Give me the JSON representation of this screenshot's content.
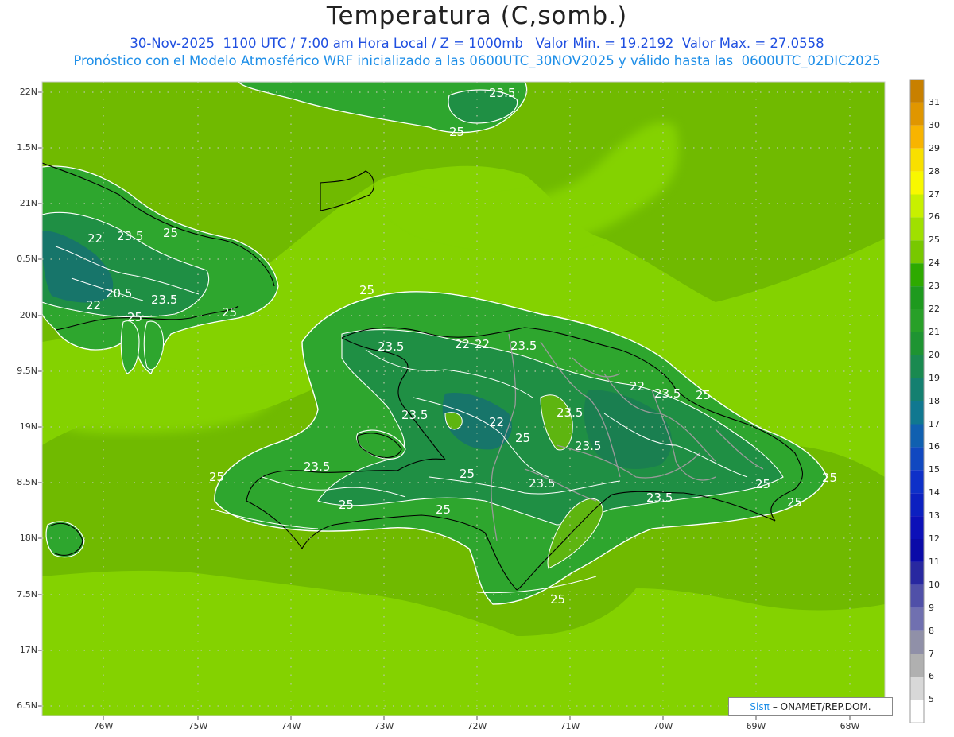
{
  "header": {
    "title": "Temperatura (C,somb.)",
    "subtitle_1": "30-Nov-2025  1100 UTC / 7:00 am Hora Local / Z = 1000mb   Valor Min. = 19.2192  Valor Max. = 27.0558",
    "subtitle_2": "Pronóstico con el Modelo Atmosférico WRF inicializado a las 0600UTC_30NOV2025 y válido hasta las  0600UTC_02DIC2025"
  },
  "axes": {
    "lat_labels": [
      "22N",
      "1.5N",
      "21N",
      "0.5N",
      "20N",
      "9.5N",
      "19N",
      "8.5N",
      "18N",
      "7.5N",
      "17N",
      "6.5N"
    ],
    "lon_labels": [
      "76W",
      "75W",
      "74W",
      "73W",
      "72W",
      "71W",
      "70W",
      "69W",
      "68W"
    ]
  },
  "colors": {
    "ocean_far": "#84d200",
    "ocean_mid": "#6fba00",
    "land_warm": "#2ea62e",
    "land_cool": "#1f8f44",
    "land_coldest": "#17756a",
    "contour": "#ffffff",
    "border": "#9a9a9a",
    "coast": "#000000"
  },
  "contour_labels": [
    "23.5",
    "25",
    "22",
    "23.5",
    "25",
    "20.5",
    "23.5",
    "22",
    "25",
    "25",
    "25",
    "23.5",
    "22",
    "22",
    "23.5",
    "22",
    "23.5",
    "25",
    "23.5",
    "22",
    "25",
    "23.5",
    "23.5",
    "25",
    "23.5",
    "25",
    "23.5",
    "23.5",
    "25",
    "25",
    "25",
    "25",
    "25",
    "25"
  ],
  "colorbar": {
    "levels": [
      "31",
      "30",
      "29",
      "28",
      "27",
      "26",
      "25",
      "24",
      "23",
      "22",
      "21",
      "20",
      "19",
      "18",
      "17",
      "16",
      "15",
      "14",
      "13",
      "12",
      "11",
      "10",
      "9",
      "8",
      "7",
      "6",
      "5"
    ],
    "colors": [
      "#c88000",
      "#e09600",
      "#f8b400",
      "#f8e000",
      "#f8f800",
      "#c8f000",
      "#a0e000",
      "#78c800",
      "#2eaa00",
      "#1e9a1e",
      "#28a028",
      "#1e9432",
      "#1a8a50",
      "#148070",
      "#107890",
      "#1060b0",
      "#1048c0",
      "#0e30c8",
      "#0c20c0",
      "#0c10b8",
      "#0a0aa8",
      "#2828a0",
      "#5050a8",
      "#7070b0",
      "#9090a8",
      "#b0b0b0",
      "#d8d8d8",
      "#ffffff"
    ]
  },
  "credit": {
    "brand": "Sisπ",
    "text": "– ONAMET/REP.DOM."
  }
}
